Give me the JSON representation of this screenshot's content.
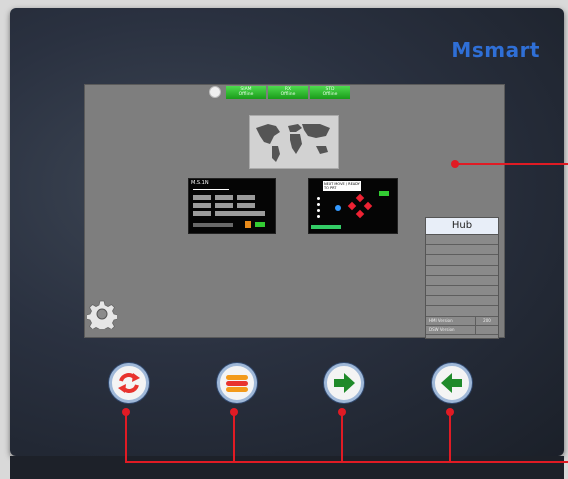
{
  "brand": "Msmart",
  "status_bar": {
    "cells": [
      {
        "name": "SIAM",
        "state": "Offline"
      },
      {
        "name": "RX",
        "state": "Offline"
      },
      {
        "name": "STD",
        "state": "Offline"
      }
    ]
  },
  "hub_panel": {
    "title": "Hub",
    "footer": [
      {
        "label": "HMI Version",
        "value": "200"
      },
      {
        "label": "DSW Version",
        "value": ""
      }
    ]
  },
  "thumbnail_left": {
    "header": "M.S.1N"
  },
  "thumbnail_right": {
    "header": "NEXT MOVE / READY TO PRT"
  },
  "buttons": [
    {
      "name": "refresh",
      "icon": "refresh-icon",
      "color": "#e8332e"
    },
    {
      "name": "menu",
      "icon": "menu-icon",
      "color": "#f39a1a"
    },
    {
      "name": "next",
      "icon": "arrow-right-icon",
      "color": "#1f8a2a"
    },
    {
      "name": "back",
      "icon": "arrow-left-icon",
      "color": "#1f8a2a"
    }
  ],
  "colors": {
    "accent": "#2f6fd6",
    "callout": "#e01b24",
    "status_green": "#2db52d"
  }
}
